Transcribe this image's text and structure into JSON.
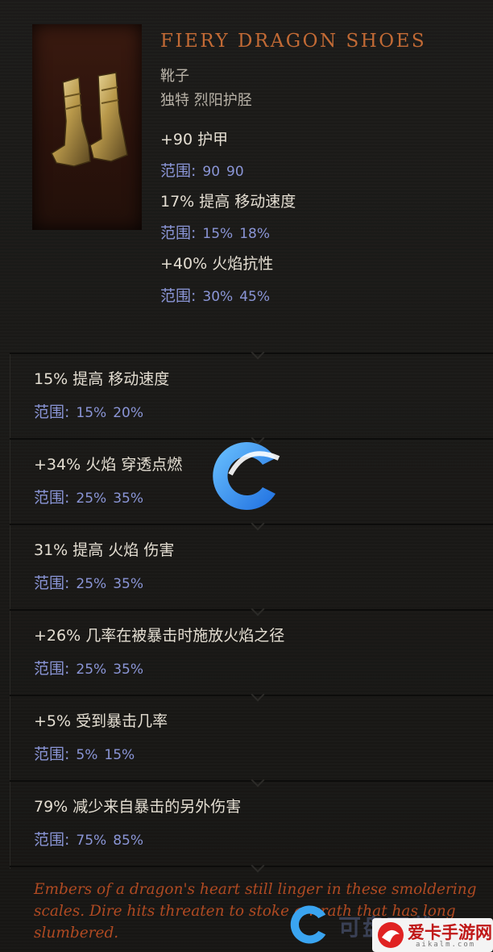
{
  "item": {
    "name": "FIERY DRAGON SHOES",
    "type": "靴子",
    "rarity": "独特 烈阳护胫",
    "image_icon": "golden-boots-icon"
  },
  "base_stats": [
    {
      "stat": "+90 护甲",
      "range_label": "范围:",
      "min": "90",
      "max": "90"
    },
    {
      "stat": "17% 提高 移动速度",
      "range_label": "范围:",
      "min": "15%",
      "max": "18%"
    },
    {
      "stat": "+40% 火焰抗性",
      "range_label": "范围:",
      "min": "30%",
      "max": "45%"
    }
  ],
  "affixes": [
    {
      "stat": "15% 提高 移动速度",
      "range_label": "范围:",
      "min": "15%",
      "max": "20%"
    },
    {
      "stat": "+34% 火焰 穿透点燃",
      "range_label": "范围:",
      "min": "25%",
      "max": "35%"
    },
    {
      "stat": "31% 提高 火焰 伤害",
      "range_label": "范围:",
      "min": "25%",
      "max": "35%"
    },
    {
      "stat": "+26% 几率在被暴击时施放火焰之径",
      "range_label": "范围:",
      "min": "25%",
      "max": "35%"
    },
    {
      "stat": "+5% 受到暴击几率",
      "range_label": "范围:",
      "min": "5%",
      "max": "15%"
    },
    {
      "stat": "79% 减少来自暴击的另外伤害",
      "range_label": "范围:",
      "min": "75%",
      "max": "85%"
    }
  ],
  "flavor_text": "Embers of a dragon's heart still linger in these smoldering scales. Dire hits threaten to stoke a wrath that has long slumbered.",
  "watermark": {
    "text": "可盘下载",
    "site": "爱卡手游网",
    "domain": "aikalm.com"
  },
  "colors": {
    "item_name": "#c26a35",
    "range": "#8a95d6",
    "flavor": "#b04a22",
    "logo_blue": "#2f8fe8"
  }
}
